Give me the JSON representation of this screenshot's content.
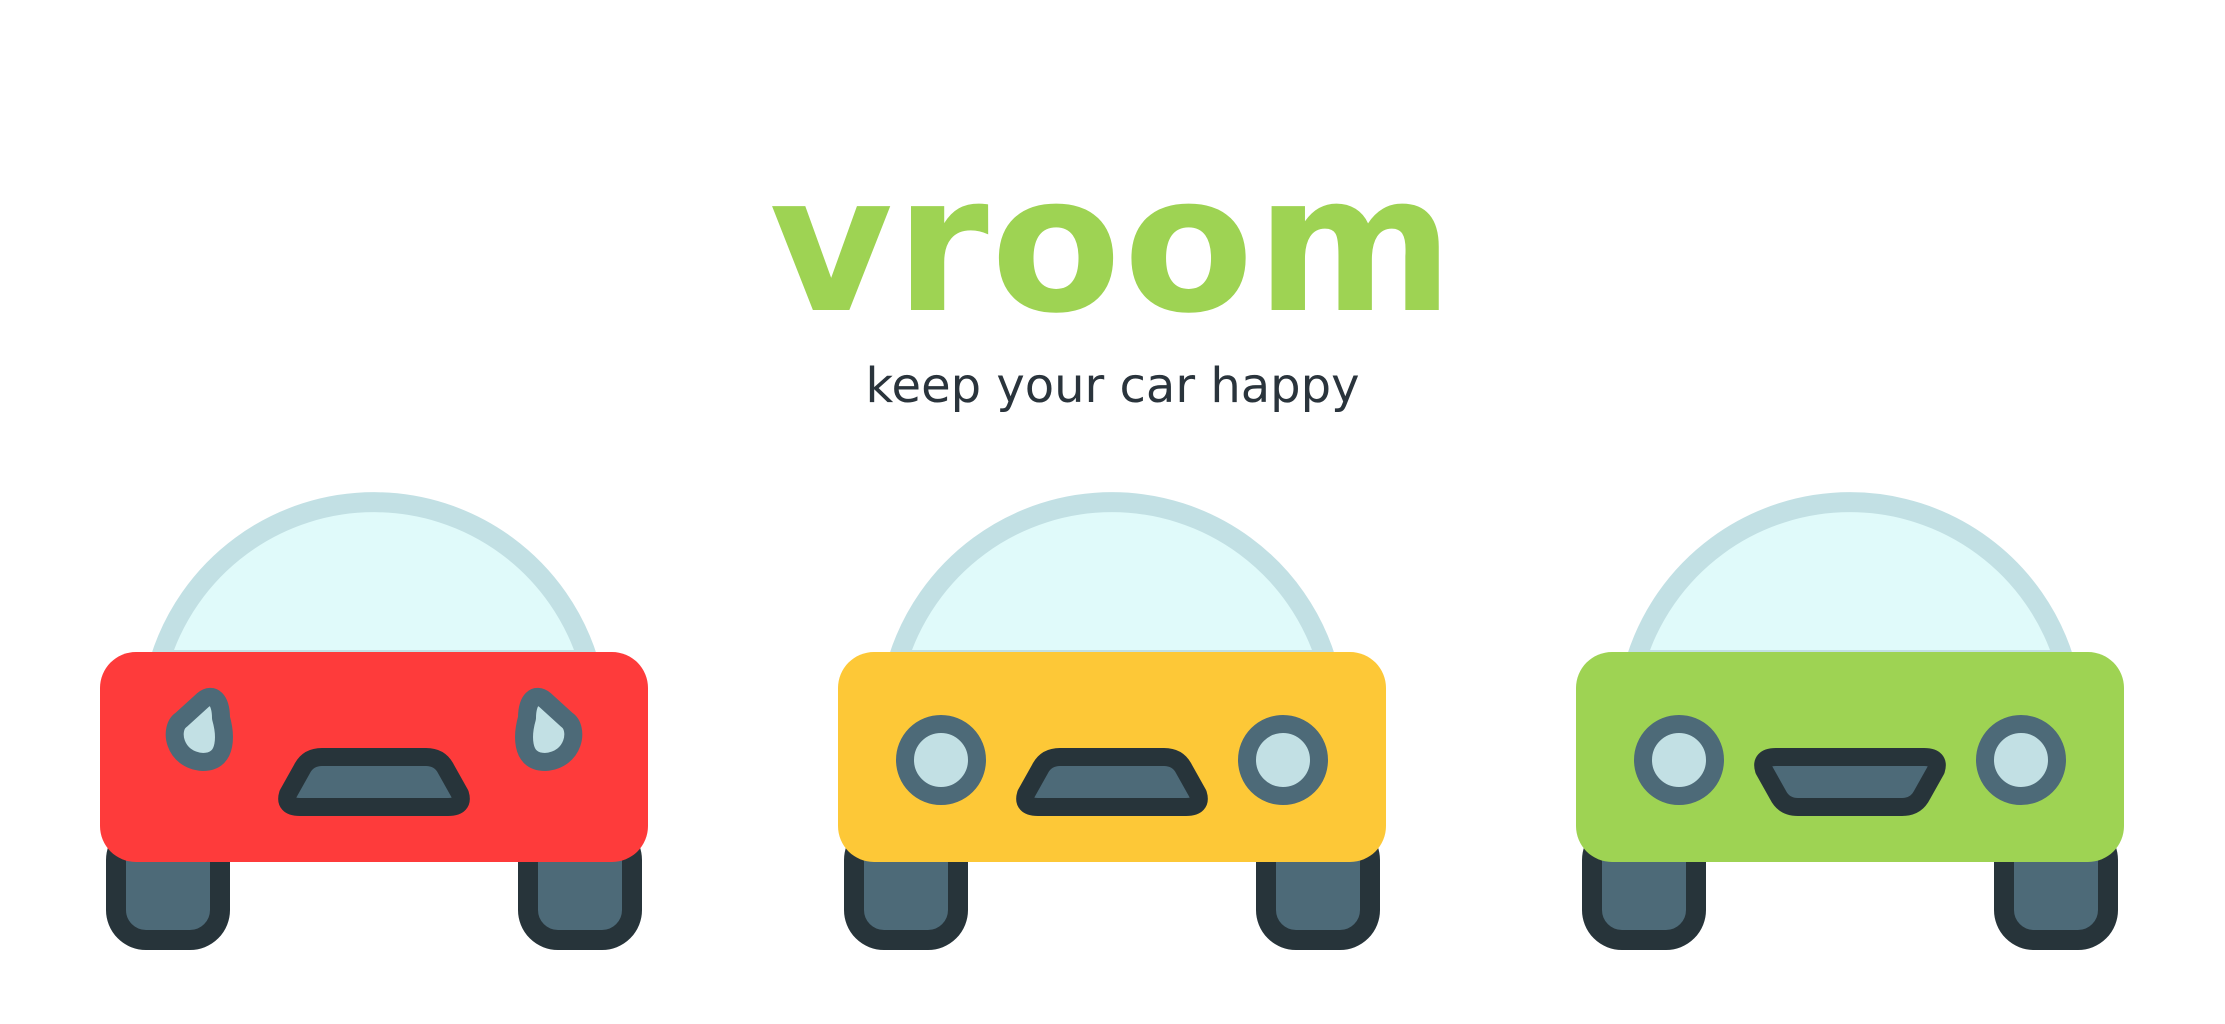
{
  "brand": {
    "title": "vroom",
    "tagline": "keep your car happy"
  },
  "colors": {
    "brand_green": "#9ed353",
    "tagline_text": "#2a343c",
    "window_fill": "#e0fafa",
    "window_rim": "#c2e0e4",
    "outline": "#27343a",
    "panel_fill": "#4d6a78",
    "light_fill": "#c2e0e4"
  },
  "cars": [
    {
      "color": "#fe3b3b",
      "expression": "crying",
      "icon": "crying-car-icon"
    },
    {
      "color": "#fdc837",
      "expression": "neutral",
      "icon": "neutral-car-icon"
    },
    {
      "color": "#9ed353",
      "expression": "happy",
      "icon": "happy-car-icon"
    }
  ]
}
